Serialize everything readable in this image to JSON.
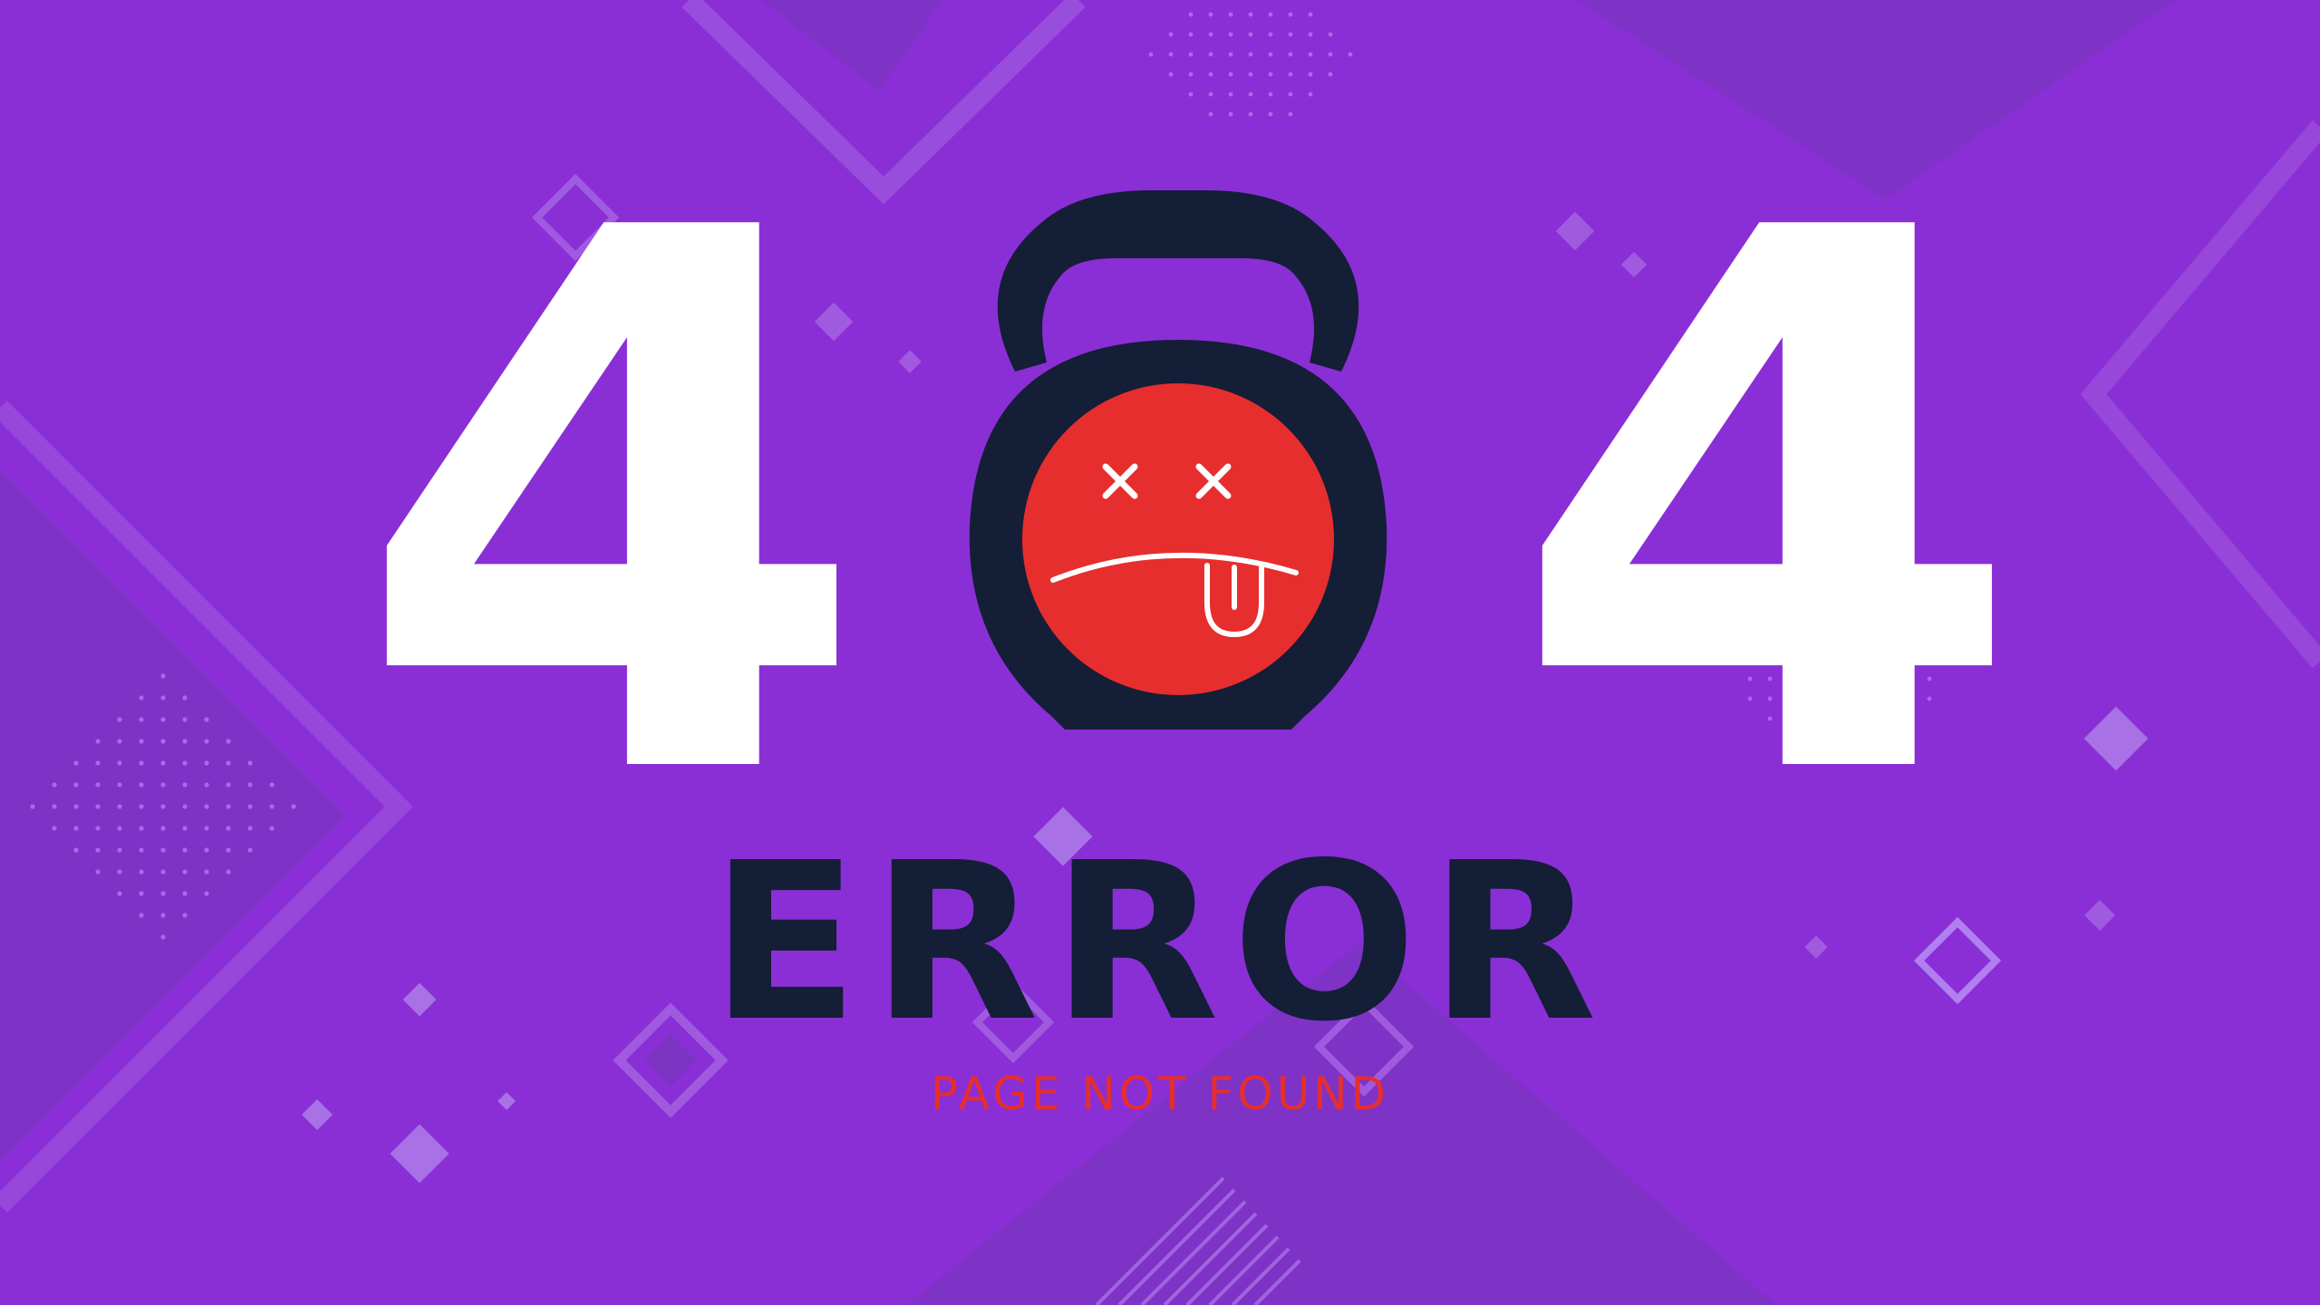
{
  "error_code": {
    "first_digit": "4",
    "last_digit": "4",
    "middle_icon": "kettlebell-dead-face-icon"
  },
  "headline": "ERROR",
  "subtitle": "PAGE NOT FOUND",
  "colors": {
    "background": "#8a2fd5",
    "digits": "#ffffff",
    "headline": "#141e36",
    "subtitle": "#e62e2e",
    "face": "#e62e2e",
    "kettlebell": "#141e36"
  }
}
